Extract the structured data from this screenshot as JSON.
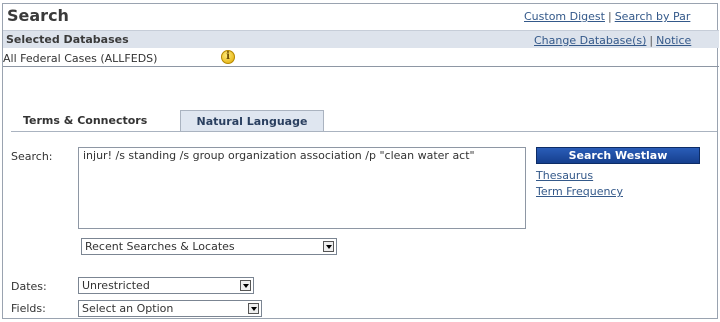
{
  "header": {
    "title": "Search",
    "links": [
      "Custom Digest",
      "Search by Par"
    ]
  },
  "databases": {
    "header_label": "Selected Databases",
    "links": [
      "Change Database(s)",
      "Notice"
    ],
    "selected": "All Federal Cases (ALLFEDS)",
    "info_icon": "info-icon"
  },
  "tabs": [
    {
      "label": "Terms & Connectors",
      "active": true
    },
    {
      "label": "Natural Language",
      "active": false
    }
  ],
  "search": {
    "label": "Search:",
    "query": "injur! /s standing /s group organization association /p \"clean water act\"",
    "button_label": "Search Westlaw",
    "links": {
      "thesaurus": "Thesaurus",
      "term_frequency": "Term Frequency"
    },
    "recent_select": "Recent Searches & Locates"
  },
  "filters": {
    "dates_label": "Dates:",
    "dates_value": "Unrestricted",
    "fields_label": "Fields:",
    "fields_value": "Select an Option"
  },
  "colors": {
    "accent": "#1d4ea3",
    "link": "#34598a",
    "header_bg": "#dde3ec"
  }
}
